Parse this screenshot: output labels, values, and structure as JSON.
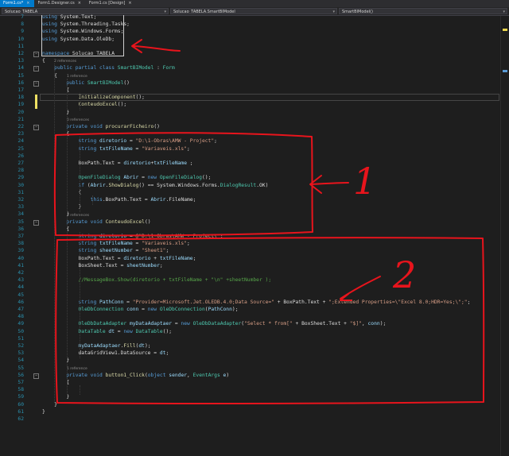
{
  "tabs": [
    {
      "label": "Form1.cs*",
      "active": true
    },
    {
      "label": "Form1.Designer.cs",
      "active": false
    },
    {
      "label": "Form1.cs [Design]",
      "active": false
    }
  ],
  "nav": {
    "project": "Solucao_TABELA",
    "class": "Solucao_TABELA.SmartBIModel",
    "member": "SmartBIModel()"
  },
  "lines": [
    {
      "n": "7",
      "code": [
        [
          "kw",
          "using "
        ],
        [
          "tx",
          "System.Text;"
        ]
      ]
    },
    {
      "n": "8",
      "code": [
        [
          "kw",
          "using "
        ],
        [
          "tx",
          "System.Threading.Tasks;"
        ]
      ]
    },
    {
      "n": "9",
      "code": [
        [
          "kw",
          "using "
        ],
        [
          "tx",
          "System.Windows.Forms;"
        ]
      ]
    },
    {
      "n": "10",
      "code": [
        [
          "kw",
          "using "
        ],
        [
          "tx",
          "System.Data.OleDb;"
        ]
      ]
    },
    {
      "n": "11",
      "code": []
    },
    {
      "n": "12",
      "code": [
        [
          "kw",
          "namespace "
        ],
        [
          "tx",
          "Solucao_TABELA"
        ]
      ]
    },
    {
      "n": "13",
      "code": [
        [
          "tx",
          "{"
        ]
      ]
    },
    {
      "n": "14",
      "code": [
        [
          "tx",
          "    "
        ],
        [
          "kw",
          "public partial class "
        ],
        [
          "ty",
          "SmartBIModel"
        ],
        [
          "tx",
          " : "
        ],
        [
          "ty",
          "Form"
        ]
      ]
    },
    {
      "n": "15",
      "code": [
        [
          "tx",
          "    {"
        ]
      ]
    },
    {
      "n": "16",
      "code": [
        [
          "tx",
          "        "
        ],
        [
          "kw",
          "public "
        ],
        [
          "ty",
          "SmartBIModel"
        ],
        [
          "tx",
          "()"
        ]
      ]
    },
    {
      "n": "17",
      "code": [
        [
          "tx",
          "        {"
        ]
      ]
    },
    {
      "n": "18",
      "code": [
        [
          "tx",
          "            "
        ],
        [
          "mt",
          "InitializeComponent"
        ],
        [
          "tx",
          "();"
        ]
      ]
    },
    {
      "n": "19",
      "code": [
        [
          "tx",
          "            "
        ],
        [
          "mt",
          "ConteudoExcel"
        ],
        [
          "tx",
          "();"
        ]
      ]
    },
    {
      "n": "20",
      "code": [
        [
          "tx",
          "        }"
        ]
      ]
    },
    {
      "n": "21",
      "code": []
    },
    {
      "n": "22",
      "code": [
        [
          "tx",
          "        "
        ],
        [
          "kw",
          "private void "
        ],
        [
          "mt",
          "procurarFicheiro"
        ],
        [
          "tx",
          "()"
        ]
      ]
    },
    {
      "n": "23",
      "code": [
        [
          "tx",
          "        {"
        ]
      ]
    },
    {
      "n": "24",
      "code": [
        [
          "tx",
          "            "
        ],
        [
          "kw",
          "string "
        ],
        [
          "vr",
          "diretorio"
        ],
        [
          "tx",
          " = "
        ],
        [
          "str",
          "\"D:\\1-Obras\\AMW - Project\""
        ],
        [
          "tx",
          ";"
        ]
      ]
    },
    {
      "n": "25",
      "code": [
        [
          "tx",
          "            "
        ],
        [
          "kw",
          "string "
        ],
        [
          "vr",
          "txtFileName"
        ],
        [
          "tx",
          " = "
        ],
        [
          "str",
          "\"Variaveis.xls\""
        ],
        [
          "tx",
          ";"
        ]
      ]
    },
    {
      "n": "26",
      "code": []
    },
    {
      "n": "27",
      "code": [
        [
          "tx",
          "            BoxPath.Text = "
        ],
        [
          "vr",
          "diretorio"
        ],
        [
          "tx",
          "+"
        ],
        [
          "vr",
          "txtFileName"
        ],
        [
          "tx",
          " ;"
        ]
      ]
    },
    {
      "n": "28",
      "code": []
    },
    {
      "n": "29",
      "code": [
        [
          "tx",
          "            "
        ],
        [
          "ty",
          "OpenFileDialog "
        ],
        [
          "vr",
          "Abrir"
        ],
        [
          "tx",
          " = "
        ],
        [
          "kw",
          "new "
        ],
        [
          "ty",
          "OpenFileDialog"
        ],
        [
          "tx",
          "();"
        ]
      ]
    },
    {
      "n": "30",
      "code": [
        [
          "tx",
          "            "
        ],
        [
          "kw",
          "if "
        ],
        [
          "tx",
          "("
        ],
        [
          "vr",
          "Abrir"
        ],
        [
          "tx",
          "."
        ],
        [
          "mt",
          "ShowDialog"
        ],
        [
          "tx",
          "() == System.Windows.Forms."
        ],
        [
          "ty",
          "DialogResult"
        ],
        [
          "tx",
          ".OK)"
        ]
      ]
    },
    {
      "n": "31",
      "code": [
        [
          "tx",
          "            {"
        ]
      ]
    },
    {
      "n": "32",
      "code": [
        [
          "tx",
          "                "
        ],
        [
          "kw",
          "this"
        ],
        [
          "tx",
          ".BoxPath.Text = "
        ],
        [
          "vr",
          "Abrir"
        ],
        [
          "tx",
          ".FileName;"
        ]
      ]
    },
    {
      "n": "33",
      "code": [
        [
          "tx",
          "            }"
        ]
      ]
    },
    {
      "n": "34",
      "code": [
        [
          "tx",
          "        }"
        ]
      ]
    },
    {
      "n": "35",
      "code": [
        [
          "tx",
          "        "
        ],
        [
          "kw",
          "private void "
        ],
        [
          "mt",
          "ConteudoExcel"
        ],
        [
          "tx",
          "()"
        ]
      ]
    },
    {
      "n": "36",
      "code": [
        [
          "tx",
          "        {"
        ]
      ]
    },
    {
      "n": "37",
      "code": [
        [
          "tx",
          "            "
        ],
        [
          "kw",
          "string "
        ],
        [
          "vr",
          "diretorio"
        ],
        [
          "tx",
          " = "
        ],
        [
          "str",
          "@\"D:\\1-Obras\\AMW - Project\\\""
        ],
        [
          "tx",
          ";"
        ]
      ]
    },
    {
      "n": "38",
      "code": [
        [
          "tx",
          "            "
        ],
        [
          "kw",
          "string "
        ],
        [
          "vr",
          "txtFileName"
        ],
        [
          "tx",
          " = "
        ],
        [
          "str",
          "\"Variaveis.xls\""
        ],
        [
          "tx",
          ";"
        ]
      ]
    },
    {
      "n": "39",
      "code": [
        [
          "tx",
          "            "
        ],
        [
          "kw",
          "string "
        ],
        [
          "vr",
          "sheetNumber"
        ],
        [
          "tx",
          " = "
        ],
        [
          "str",
          "\"Sheet1\""
        ],
        [
          "tx",
          ";"
        ]
      ]
    },
    {
      "n": "40",
      "code": [
        [
          "tx",
          "            BoxPath.Text = "
        ],
        [
          "vr",
          "diretorio"
        ],
        [
          "tx",
          " + "
        ],
        [
          "vr",
          "txtFileName"
        ],
        [
          "tx",
          ";"
        ]
      ]
    },
    {
      "n": "41",
      "code": [
        [
          "tx",
          "            BoxSheet.Text = "
        ],
        [
          "vr",
          "sheetNumber"
        ],
        [
          "tx",
          ";"
        ]
      ]
    },
    {
      "n": "42",
      "code": []
    },
    {
      "n": "43",
      "code": [
        [
          "tx",
          "            "
        ],
        [
          "cm",
          "//MessageBox.Show(diretorio + txtFileName + \"\\n\" +sheetNumber );"
        ]
      ]
    },
    {
      "n": "44",
      "code": []
    },
    {
      "n": "45",
      "code": []
    },
    {
      "n": "46",
      "code": [
        [
          "tx",
          "            "
        ],
        [
          "kw",
          "string "
        ],
        [
          "vr",
          "PathConn"
        ],
        [
          "tx",
          " = "
        ],
        [
          "str",
          "\"Provider=Microsoft.Jet.OLEDB.4.0;Data Source=\""
        ],
        [
          "tx",
          " + BoxPath.Text + "
        ],
        [
          "str",
          "\";Extended Properties=\\\"Excel 8.0;HDR=Yes;\\\";\""
        ],
        [
          "tx",
          ";"
        ]
      ]
    },
    {
      "n": "47",
      "code": [
        [
          "tx",
          "            "
        ],
        [
          "ty",
          "OleDbConnection "
        ],
        [
          "vr",
          "conn"
        ],
        [
          "tx",
          " = "
        ],
        [
          "kw",
          "new "
        ],
        [
          "ty",
          "OleDbConnection"
        ],
        [
          "tx",
          "("
        ],
        [
          "vr",
          "PathConn"
        ],
        [
          "tx",
          ");"
        ]
      ]
    },
    {
      "n": "48",
      "code": []
    },
    {
      "n": "49",
      "code": [
        [
          "tx",
          "            "
        ],
        [
          "ty",
          "OleDbDataAdapter "
        ],
        [
          "vr",
          "myDataAdaptaer"
        ],
        [
          "tx",
          " = "
        ],
        [
          "kw",
          "new "
        ],
        [
          "ty",
          "OleDbDataAdapter"
        ],
        [
          "tx",
          "("
        ],
        [
          "str",
          "\"Select * from[\""
        ],
        [
          "tx",
          " + BoxSheet.Text + "
        ],
        [
          "str",
          "\"$]\""
        ],
        [
          "tx",
          ", "
        ],
        [
          "vr",
          "conn"
        ],
        [
          "tx",
          ");"
        ]
      ]
    },
    {
      "n": "50",
      "code": [
        [
          "tx",
          "            "
        ],
        [
          "ty",
          "DataTable "
        ],
        [
          "vr",
          "dt"
        ],
        [
          "tx",
          " = "
        ],
        [
          "kw",
          "new "
        ],
        [
          "ty",
          "DataTable"
        ],
        [
          "tx",
          "();"
        ]
      ]
    },
    {
      "n": "51",
      "code": []
    },
    {
      "n": "52",
      "code": [
        [
          "tx",
          "            "
        ],
        [
          "vr",
          "myDataAdaptaer"
        ],
        [
          "tx",
          "."
        ],
        [
          "mt",
          "Fill"
        ],
        [
          "tx",
          "("
        ],
        [
          "vr",
          "dt"
        ],
        [
          "tx",
          ");"
        ]
      ]
    },
    {
      "n": "53",
      "code": [
        [
          "tx",
          "            dataGridView1.DataSource = "
        ],
        [
          "vr",
          "dt"
        ],
        [
          "tx",
          ";"
        ]
      ]
    },
    {
      "n": "54",
      "code": [
        [
          "tx",
          "        }"
        ]
      ]
    },
    {
      "n": "55",
      "code": []
    },
    {
      "n": "56",
      "code": [
        [
          "tx",
          "        "
        ],
        [
          "kw",
          "private void "
        ],
        [
          "mt",
          "button1_Click"
        ],
        [
          "tx",
          "("
        ],
        [
          "kw",
          "object "
        ],
        [
          "vr",
          "sender"
        ],
        [
          "tx",
          ", "
        ],
        [
          "ty",
          "EventArgs "
        ],
        [
          "vr",
          "e"
        ],
        [
          "tx",
          ")"
        ]
      ]
    },
    {
      "n": "57",
      "code": [
        [
          "tx",
          "        {"
        ]
      ]
    },
    {
      "n": "58",
      "code": []
    },
    {
      "n": "59",
      "code": [
        [
          "tx",
          "        }"
        ]
      ]
    },
    {
      "n": "60",
      "code": [
        [
          "tx",
          "    }"
        ]
      ]
    },
    {
      "n": "61",
      "code": [
        [
          "tx",
          "}"
        ]
      ]
    },
    {
      "n": "62",
      "code": []
    }
  ],
  "refs": [
    {
      "line": "14",
      "text": "2 references"
    },
    {
      "line": "16",
      "text": "1 reference"
    },
    {
      "line": "22",
      "text": "0 references"
    },
    {
      "line": "35",
      "text": "2 references"
    },
    {
      "line": "56",
      "text": "1 reference"
    }
  ],
  "annotations": {
    "label_1": "1",
    "label_2": "2",
    "color": "#e8141c"
  }
}
